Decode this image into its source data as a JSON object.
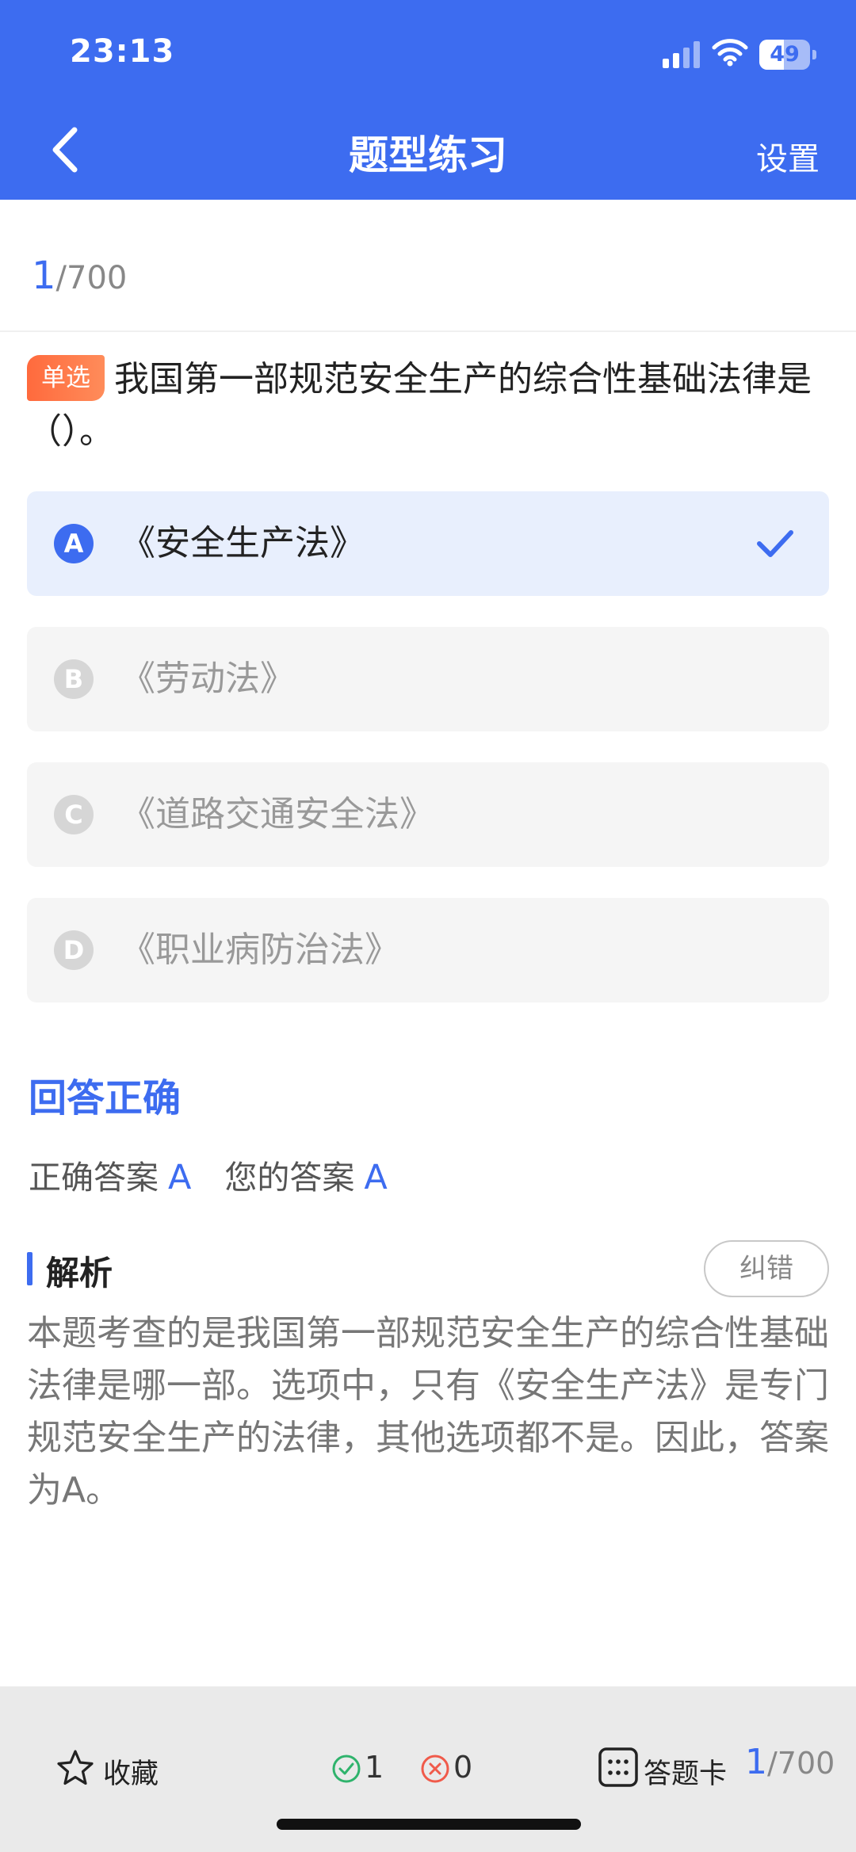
{
  "status_bar": {
    "time": "23:13",
    "battery": "49",
    "battery_level": 0.49,
    "icons": [
      "signal-icon",
      "wifi-icon",
      "battery-icon"
    ]
  },
  "nav": {
    "title": "题型练习",
    "settings_label": "设置",
    "back_icon": "chevron-left-icon"
  },
  "progress": {
    "current": "1",
    "total": "/700"
  },
  "question": {
    "type_badge": "单选",
    "text": "我国第一部规范安全生产的综合性基础法律是（）。"
  },
  "options": [
    {
      "letter": "A",
      "text": "《安全生产法》",
      "selected": true
    },
    {
      "letter": "B",
      "text": "《劳动法》",
      "selected": false
    },
    {
      "letter": "C",
      "text": "《道路交通安全法》",
      "selected": false
    },
    {
      "letter": "D",
      "text": "《职业病防治法》",
      "selected": false
    }
  ],
  "result": {
    "title": "回答正确",
    "correct_label": "正确答案",
    "correct_value": "A",
    "your_label": "您的答案",
    "your_value": "A"
  },
  "analysis": {
    "title": "解析",
    "report_label": "纠错",
    "text": "本题考查的是我国第一部规范安全生产的综合性基础法律是哪一部。选项中，只有《安全生产法》是专门规范安全生产的法律，其他选项都不是。因此，答案为A。"
  },
  "bottom_bar": {
    "favorite_label": "收藏",
    "correct_count": "1",
    "wrong_count": "0",
    "card_label": "答题卡",
    "progress_current": "1",
    "progress_total": "/700"
  },
  "colors": {
    "accent": "#3d6cf0",
    "badge": "#ff6a3d",
    "correct": "#2fb36c",
    "wrong": "#f05a4a"
  }
}
